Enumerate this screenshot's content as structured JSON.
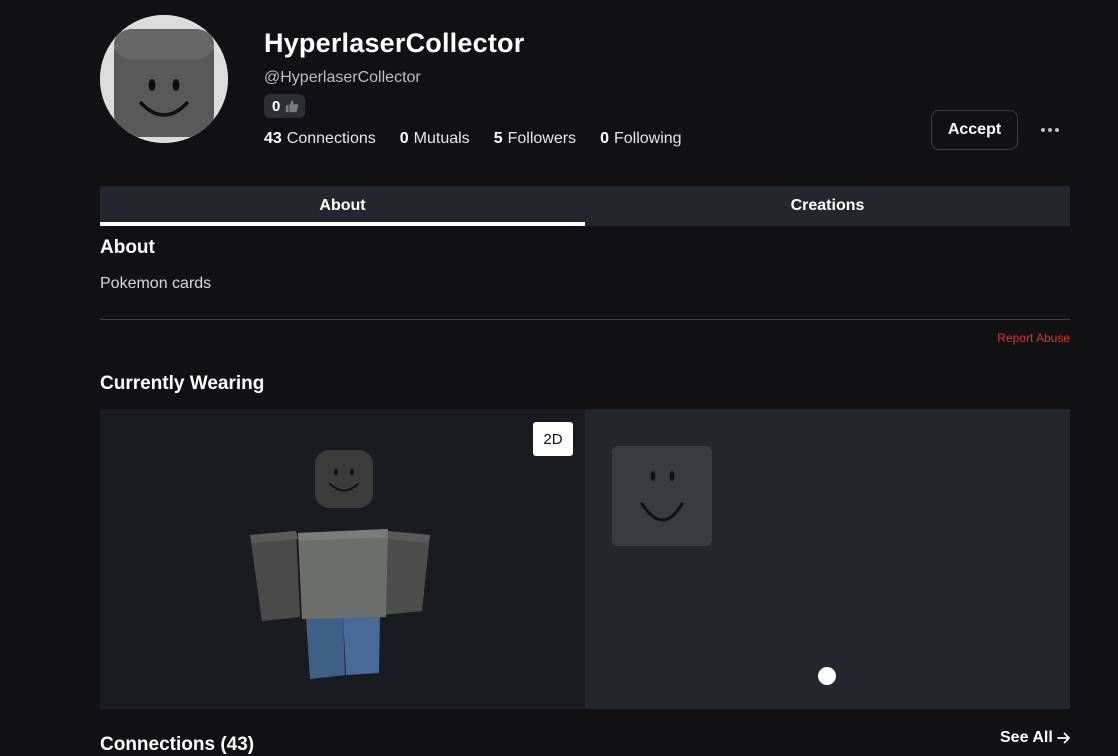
{
  "profile": {
    "display_name": "HyperlaserCollector",
    "username": "@HyperlaserCollector",
    "like_count": "0"
  },
  "stats": [
    {
      "value": "43",
      "label": "Connections"
    },
    {
      "value": "0",
      "label": "Mutuals"
    },
    {
      "value": "5",
      "label": "Followers"
    },
    {
      "value": "0",
      "label": "Following"
    }
  ],
  "actions": {
    "accept_label": "Accept"
  },
  "tabs": [
    {
      "label": "About",
      "active": true
    },
    {
      "label": "Creations",
      "active": false
    }
  ],
  "about": {
    "heading": "About",
    "text": "Pokemon cards",
    "report_abuse": "Report Abuse"
  },
  "wearing": {
    "heading": "Currently Wearing",
    "toggle_label": "2D"
  },
  "connections": {
    "heading": "Connections (43)",
    "see_all": "See All"
  },
  "icons": {
    "like": "thumbs-up-icon",
    "more": "more-horizontal-icon",
    "see_all": "arrow-right-icon"
  },
  "colors": {
    "background": "#111114",
    "panel": "#24262d",
    "report_abuse": "#e0302a"
  }
}
